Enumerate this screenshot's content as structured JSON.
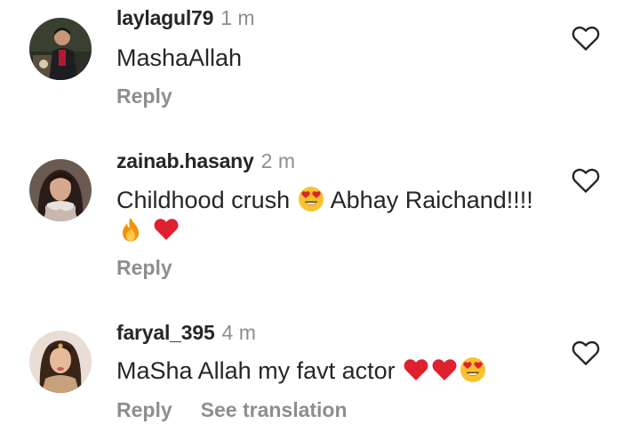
{
  "comments": [
    {
      "username": "laylagul79",
      "time": "1 m",
      "text": "MashaAllah",
      "reply_label": "Reply",
      "avatar_icon": "avatar-laylagul79",
      "like_icon": "heart-outline-icon"
    },
    {
      "username": "zainab.hasany",
      "time": "2 m",
      "text_part1": "Childhood crush",
      "text_part2": "Abhay Raichand!!!!",
      "reply_label": "Reply",
      "avatar_icon": "avatar-zainab-hasany",
      "like_icon": "heart-outline-icon"
    },
    {
      "username": "faryal_395",
      "time": "4 m",
      "text": "MaSha Allah my favt actor",
      "reply_label": "Reply",
      "translate_label": "See translation",
      "avatar_icon": "avatar-faryal-395",
      "like_icon": "heart-outline-icon"
    }
  ],
  "colors": {
    "text": "#262626",
    "secondary": "#8e8e8e",
    "heart_emoji": "#e0202e",
    "face_emoji": "#f9c22e"
  }
}
